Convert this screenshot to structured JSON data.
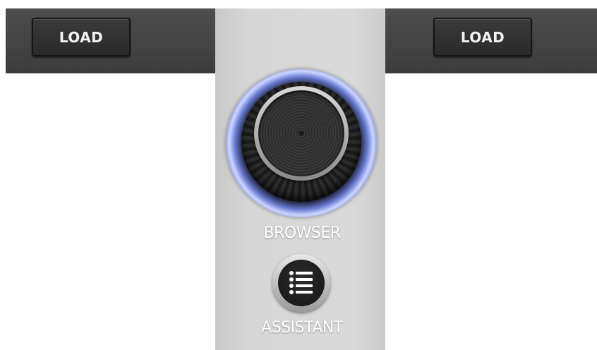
{
  "deck_left": {
    "load_label": "LOAD"
  },
  "deck_right": {
    "load_label": "LOAD"
  },
  "browser": {
    "label": "BROWSER",
    "accent_color": "#7f8fe0"
  },
  "assistant": {
    "label": "ASSISTANT",
    "icon": "list-icon"
  }
}
